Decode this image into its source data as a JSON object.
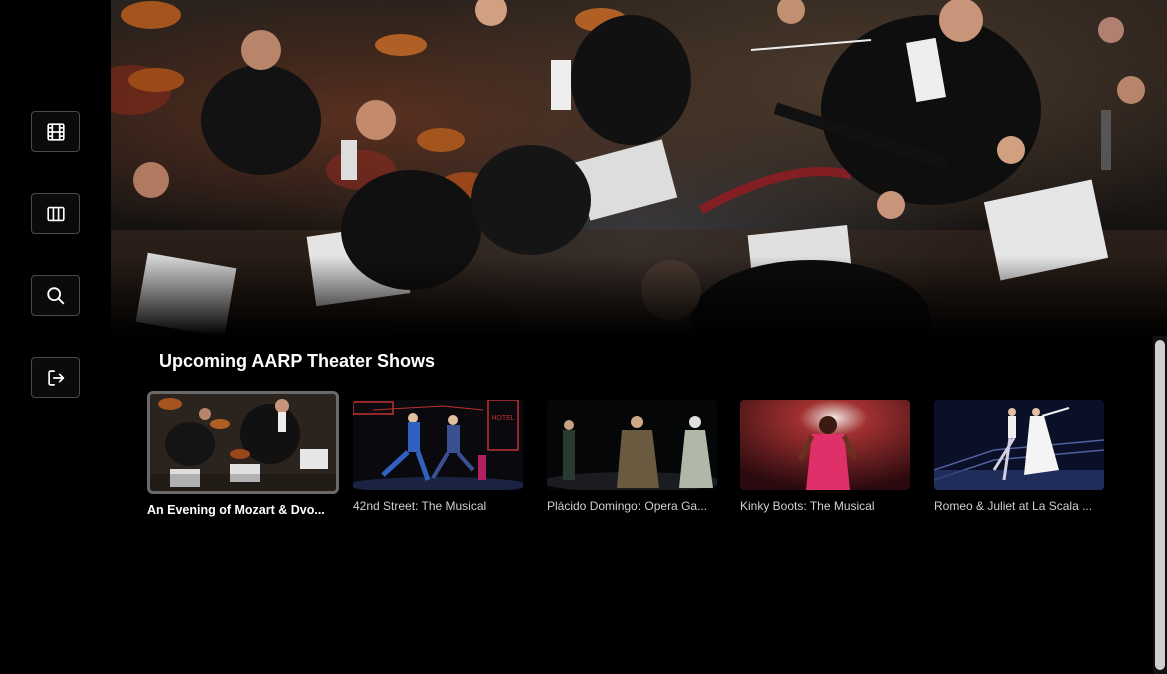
{
  "sidebar": {
    "items": [
      {
        "icon": "film-icon",
        "label": ""
      },
      {
        "icon": "columns-icon",
        "label": ""
      },
      {
        "icon": "search-icon",
        "label": ""
      },
      {
        "icon": "logout-icon",
        "label": ""
      }
    ]
  },
  "section": {
    "title": "Upcoming AARP Theater Shows"
  },
  "shows": [
    {
      "title": "An Evening of Mozart & Dvo...",
      "selected": true
    },
    {
      "title": "42nd Street: The Musical",
      "selected": false
    },
    {
      "title": "Plácido Domingo: Opera Ga...",
      "selected": false
    },
    {
      "title": "Kinky Boots: The Musical",
      "selected": false
    },
    {
      "title": "Romeo & Juliet at La Scala ...",
      "selected": false
    }
  ],
  "colors": {
    "background": "#000000",
    "accent_border": "#6a6a6a",
    "caption": "#cfcfcf"
  }
}
